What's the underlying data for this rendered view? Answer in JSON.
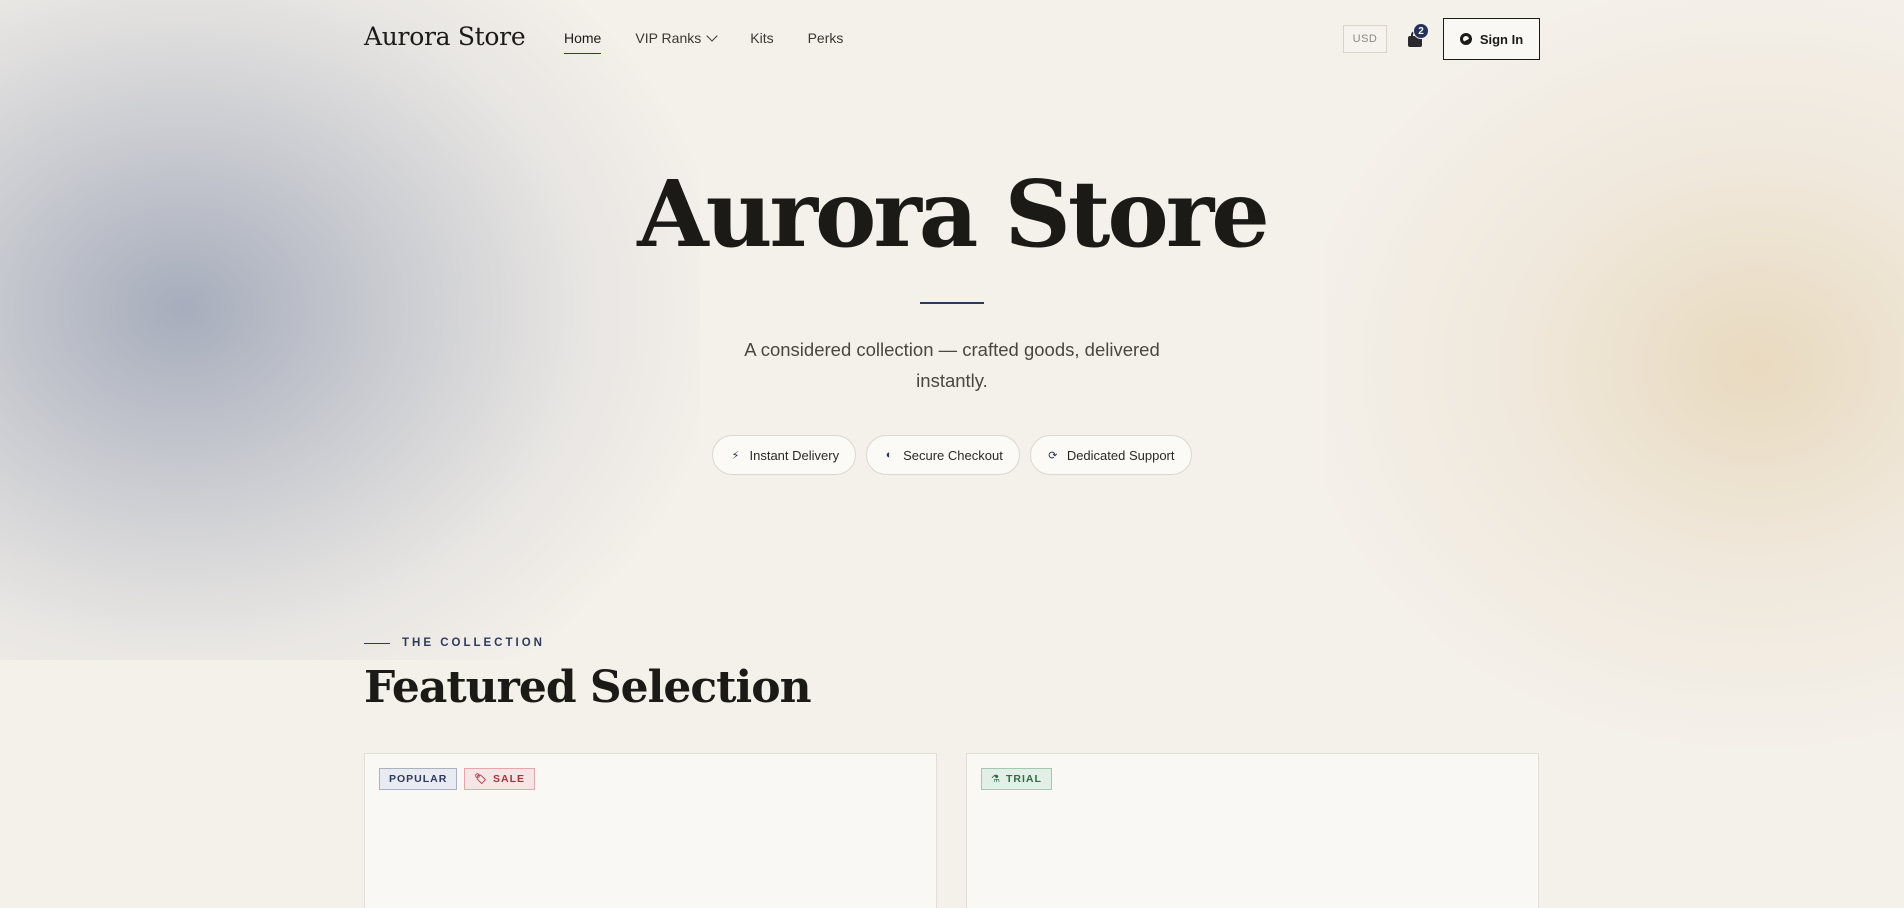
{
  "nav": {
    "brand": "Aurora Store",
    "links": [
      {
        "label": "Home",
        "active": true
      },
      {
        "label": "VIP Ranks",
        "has_dropdown": true
      },
      {
        "label": "Kits"
      },
      {
        "label": "Perks"
      }
    ],
    "currency": "USD",
    "cart_count": "2",
    "signin_label": "Sign In"
  },
  "hero": {
    "title": "Aurora Store",
    "subtitle": "A considered collection — crafted goods, delivered instantly.",
    "pills": [
      {
        "label": "Instant Delivery",
        "icon": "bolt-icon"
      },
      {
        "label": "Secure Checkout",
        "icon": "shield-icon"
      },
      {
        "label": "Dedicated Support",
        "icon": "support-icon"
      }
    ]
  },
  "collection": {
    "eyebrow": "THE COLLECTION",
    "title": "Featured Selection",
    "cards": [
      {
        "tags": [
          {
            "label": "POPULAR",
            "kind": "popular"
          },
          {
            "label": "SALE",
            "kind": "sale",
            "icon": "tag-icon"
          }
        ]
      },
      {
        "tags": [
          {
            "label": "TRIAL",
            "kind": "trial",
            "icon": "flask-icon"
          }
        ]
      }
    ]
  },
  "colors": {
    "background": "#f4f0ea",
    "accent_navy": "#223258",
    "sale_red": "#a2343b",
    "trial_green": "#2f6b47"
  }
}
